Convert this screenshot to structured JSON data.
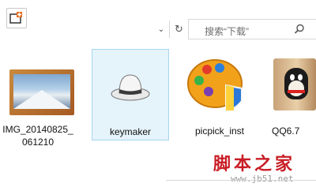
{
  "toolbar": {
    "new_folder_icon": "new-folder-icon",
    "dropdown_icon": "chevron-down-icon",
    "refresh_icon": "refresh-icon",
    "search_placeholder": "搜索“下载”",
    "search_icon": "search-icon"
  },
  "files": [
    {
      "label_line1": "IMG_20140825_",
      "label_line2": "061210",
      "icon": "photo-thumbnail"
    },
    {
      "label": "keymaker",
      "icon": "white-hat-icon",
      "selected": true
    },
    {
      "label": "picpick_inst",
      "icon": "paint-palette-shield-icon"
    },
    {
      "label": "QQ6.7",
      "icon": "qq-penguin-icon"
    }
  ],
  "watermark": {
    "text": "脚本之家",
    "url": "www.jb51.net"
  }
}
